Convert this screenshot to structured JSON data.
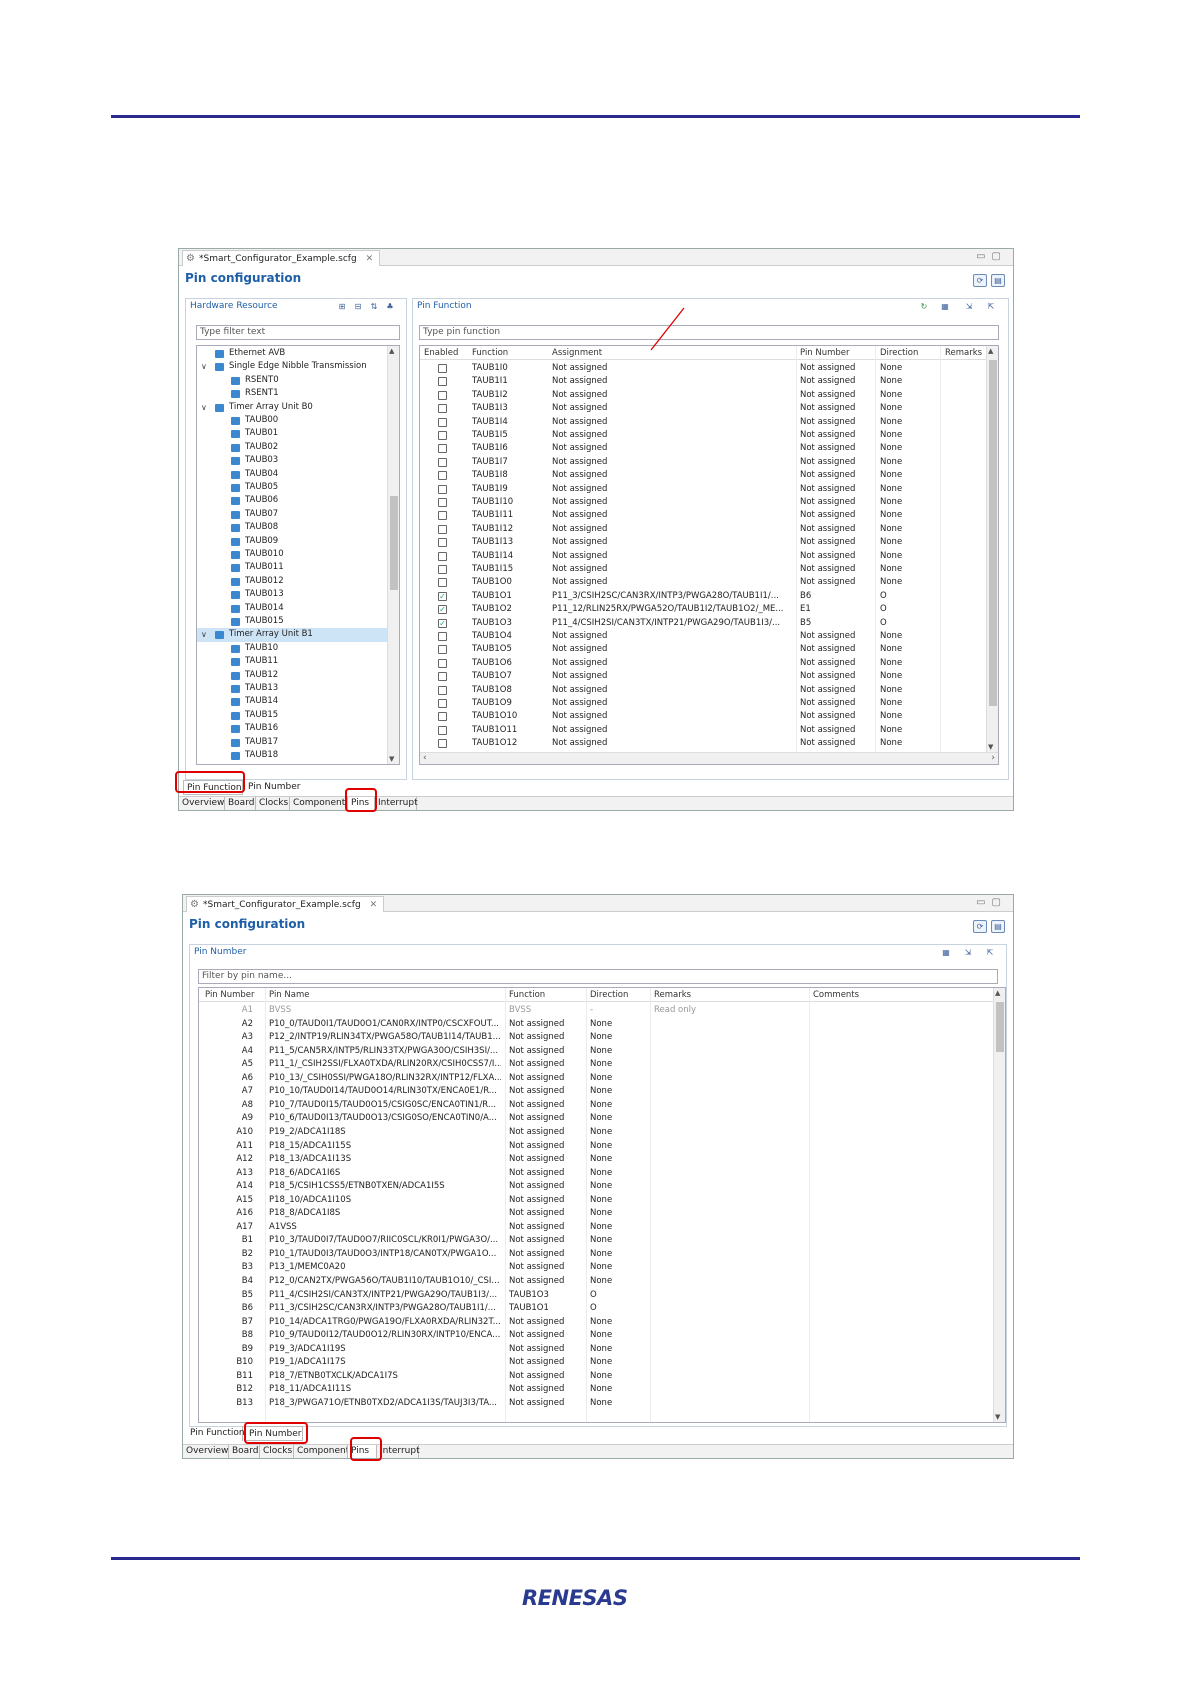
{
  "top": {
    "tab_title": "*Smart_Configurator_Example.scfg",
    "tab_close": "✕",
    "page_title": "Pin configuration",
    "left_pane": {
      "title": "Hardware Resource",
      "filter_placeholder": "Type filter text",
      "items": [
        {
          "label": "Ethernet AVB",
          "level": 1,
          "expand": "",
          "sel": false
        },
        {
          "label": "Single Edge Nibble Transmission",
          "level": 1,
          "expand": "∨",
          "sel": false
        },
        {
          "label": "RSENT0",
          "level": 2,
          "expand": "",
          "sel": false
        },
        {
          "label": "RSENT1",
          "level": 2,
          "expand": "",
          "sel": false
        },
        {
          "label": "Timer Array Unit B0",
          "level": 1,
          "expand": "∨",
          "sel": false
        },
        {
          "label": "TAUB00",
          "level": 2,
          "expand": "",
          "sel": false
        },
        {
          "label": "TAUB01",
          "level": 2,
          "expand": "",
          "sel": false
        },
        {
          "label": "TAUB02",
          "level": 2,
          "expand": "",
          "sel": false
        },
        {
          "label": "TAUB03",
          "level": 2,
          "expand": "",
          "sel": false
        },
        {
          "label": "TAUB04",
          "level": 2,
          "expand": "",
          "sel": false
        },
        {
          "label": "TAUB05",
          "level": 2,
          "expand": "",
          "sel": false
        },
        {
          "label": "TAUB06",
          "level": 2,
          "expand": "",
          "sel": false
        },
        {
          "label": "TAUB07",
          "level": 2,
          "expand": "",
          "sel": false
        },
        {
          "label": "TAUB08",
          "level": 2,
          "expand": "",
          "sel": false
        },
        {
          "label": "TAUB09",
          "level": 2,
          "expand": "",
          "sel": false
        },
        {
          "label": "TAUB010",
          "level": 2,
          "expand": "",
          "sel": false
        },
        {
          "label": "TAUB011",
          "level": 2,
          "expand": "",
          "sel": false
        },
        {
          "label": "TAUB012",
          "level": 2,
          "expand": "",
          "sel": false
        },
        {
          "label": "TAUB013",
          "level": 2,
          "expand": "",
          "sel": false
        },
        {
          "label": "TAUB014",
          "level": 2,
          "expand": "",
          "sel": false
        },
        {
          "label": "TAUB015",
          "level": 2,
          "expand": "",
          "sel": false
        },
        {
          "label": "Timer Array Unit B1",
          "level": 1,
          "expand": "∨",
          "sel": true
        },
        {
          "label": "TAUB10",
          "level": 2,
          "expand": "",
          "sel": false
        },
        {
          "label": "TAUB11",
          "level": 2,
          "expand": "",
          "sel": false
        },
        {
          "label": "TAUB12",
          "level": 2,
          "expand": "",
          "sel": false
        },
        {
          "label": "TAUB13",
          "level": 2,
          "expand": "",
          "sel": false
        },
        {
          "label": "TAUB14",
          "level": 2,
          "expand": "",
          "sel": false
        },
        {
          "label": "TAUB15",
          "level": 2,
          "expand": "",
          "sel": false
        },
        {
          "label": "TAUB16",
          "level": 2,
          "expand": "",
          "sel": false
        },
        {
          "label": "TAUB17",
          "level": 2,
          "expand": "",
          "sel": false
        },
        {
          "label": "TAUB18",
          "level": 2,
          "expand": "",
          "sel": false
        }
      ]
    },
    "right_pane": {
      "title": "Pin Function",
      "filter_placeholder": "Type pin function",
      "columns": [
        "Enabled",
        "Function",
        "Assignment",
        "Pin Number",
        "Direction",
        "Remarks"
      ],
      "rows": [
        {
          "checked": false,
          "function": "TAUB1I0",
          "assignment": "Not assigned",
          "pin": "Not assigned",
          "direction": "None"
        },
        {
          "checked": false,
          "function": "TAUB1I1",
          "assignment": "Not assigned",
          "pin": "Not assigned",
          "direction": "None"
        },
        {
          "checked": false,
          "function": "TAUB1I2",
          "assignment": "Not assigned",
          "pin": "Not assigned",
          "direction": "None"
        },
        {
          "checked": false,
          "function": "TAUB1I3",
          "assignment": "Not assigned",
          "pin": "Not assigned",
          "direction": "None"
        },
        {
          "checked": false,
          "function": "TAUB1I4",
          "assignment": "Not assigned",
          "pin": "Not assigned",
          "direction": "None"
        },
        {
          "checked": false,
          "function": "TAUB1I5",
          "assignment": "Not assigned",
          "pin": "Not assigned",
          "direction": "None"
        },
        {
          "checked": false,
          "function": "TAUB1I6",
          "assignment": "Not assigned",
          "pin": "Not assigned",
          "direction": "None"
        },
        {
          "checked": false,
          "function": "TAUB1I7",
          "assignment": "Not assigned",
          "pin": "Not assigned",
          "direction": "None"
        },
        {
          "checked": false,
          "function": "TAUB1I8",
          "assignment": "Not assigned",
          "pin": "Not assigned",
          "direction": "None"
        },
        {
          "checked": false,
          "function": "TAUB1I9",
          "assignment": "Not assigned",
          "pin": "Not assigned",
          "direction": "None"
        },
        {
          "checked": false,
          "function": "TAUB1I10",
          "assignment": "Not assigned",
          "pin": "Not assigned",
          "direction": "None"
        },
        {
          "checked": false,
          "function": "TAUB1I11",
          "assignment": "Not assigned",
          "pin": "Not assigned",
          "direction": "None"
        },
        {
          "checked": false,
          "function": "TAUB1I12",
          "assignment": "Not assigned",
          "pin": "Not assigned",
          "direction": "None"
        },
        {
          "checked": false,
          "function": "TAUB1I13",
          "assignment": "Not assigned",
          "pin": "Not assigned",
          "direction": "None"
        },
        {
          "checked": false,
          "function": "TAUB1I14",
          "assignment": "Not assigned",
          "pin": "Not assigned",
          "direction": "None"
        },
        {
          "checked": false,
          "function": "TAUB1I15",
          "assignment": "Not assigned",
          "pin": "Not assigned",
          "direction": "None"
        },
        {
          "checked": false,
          "function": "TAUB1O0",
          "assignment": "Not assigned",
          "pin": "Not assigned",
          "direction": "None"
        },
        {
          "checked": true,
          "function": "TAUB1O1",
          "assignment": "P11_3/CSIH2SC/CAN3RX/INTP3/PWGA28O/TAUB1I1/...",
          "pin": "B6",
          "direction": "O"
        },
        {
          "checked": true,
          "function": "TAUB1O2",
          "assignment": "P11_12/RLIN25RX/PWGA52O/TAUB1I2/TAUB1O2/_ME...",
          "pin": "E1",
          "direction": "O"
        },
        {
          "checked": true,
          "function": "TAUB1O3",
          "assignment": "P11_4/CSIH2SI/CAN3TX/INTP21/PWGA29O/TAUB1I3/...",
          "pin": "B5",
          "direction": "O"
        },
        {
          "checked": false,
          "function": "TAUB1O4",
          "assignment": "Not assigned",
          "pin": "Not assigned",
          "direction": "None"
        },
        {
          "checked": false,
          "function": "TAUB1O5",
          "assignment": "Not assigned",
          "pin": "Not assigned",
          "direction": "None"
        },
        {
          "checked": false,
          "function": "TAUB1O6",
          "assignment": "Not assigned",
          "pin": "Not assigned",
          "direction": "None"
        },
        {
          "checked": false,
          "function": "TAUB1O7",
          "assignment": "Not assigned",
          "pin": "Not assigned",
          "direction": "None"
        },
        {
          "checked": false,
          "function": "TAUB1O8",
          "assignment": "Not assigned",
          "pin": "Not assigned",
          "direction": "None"
        },
        {
          "checked": false,
          "function": "TAUB1O9",
          "assignment": "Not assigned",
          "pin": "Not assigned",
          "direction": "None"
        },
        {
          "checked": false,
          "function": "TAUB1O10",
          "assignment": "Not assigned",
          "pin": "Not assigned",
          "direction": "None"
        },
        {
          "checked": false,
          "function": "TAUB1O11",
          "assignment": "Not assigned",
          "pin": "Not assigned",
          "direction": "None"
        },
        {
          "checked": false,
          "function": "TAUB1O12",
          "assignment": "Not assigned",
          "pin": "Not assigned",
          "direction": "None"
        }
      ]
    },
    "bottom_tabs": [
      "Pin Function",
      "Pin Number"
    ],
    "editor_tabs": [
      "Overview",
      "Board",
      "Clocks",
      "Components",
      "Pins",
      "Interrupt"
    ]
  },
  "bottom": {
    "tab_title": "*Smart_Configurator_Example.scfg",
    "tab_close": "✕",
    "page_title": "Pin configuration",
    "pane_title": "Pin Number",
    "filter_placeholder": "Filter by pin name...",
    "columns": [
      "Pin Number",
      "Pin Name",
      "Function",
      "Direction",
      "Remarks",
      "Comments"
    ],
    "rows": [
      {
        "pin": "A1",
        "name": "BVSS",
        "func": "BVSS",
        "dir": "-",
        "remarks": "Read only",
        "ro": true
      },
      {
        "pin": "A2",
        "name": "P10_0/TAUD0I1/TAUD0O1/CAN0RX/INTP0/CSCXFOUT...",
        "func": "Not assigned",
        "dir": "None",
        "remarks": "",
        "ro": false
      },
      {
        "pin": "A3",
        "name": "P12_2/INTP19/RLIN34TX/PWGA58O/TAUB1I14/TAUB1...",
        "func": "Not assigned",
        "dir": "None",
        "remarks": "",
        "ro": false
      },
      {
        "pin": "A4",
        "name": "P11_5/CAN5RX/INTP5/RLIN33TX/PWGA30O/CSIH3SI/...",
        "func": "Not assigned",
        "dir": "None",
        "remarks": "",
        "ro": false
      },
      {
        "pin": "A5",
        "name": "P11_1/_CSIH2SSI/FLXA0TXDA/RLIN20RX/CSIH0CSS7/I...",
        "func": "Not assigned",
        "dir": "None",
        "remarks": "",
        "ro": false
      },
      {
        "pin": "A6",
        "name": "P10_13/_CSIH0SSI/PWGA18O/RLIN32RX/INTP12/FLXA...",
        "func": "Not assigned",
        "dir": "None",
        "remarks": "",
        "ro": false
      },
      {
        "pin": "A7",
        "name": "P10_10/TAUD0I14/TAUD0O14/RLIN30TX/ENCA0E1/R...",
        "func": "Not assigned",
        "dir": "None",
        "remarks": "",
        "ro": false
      },
      {
        "pin": "A8",
        "name": "P10_7/TAUD0I15/TAUD0O15/CSIG0SC/ENCA0TIN1/R...",
        "func": "Not assigned",
        "dir": "None",
        "remarks": "",
        "ro": false
      },
      {
        "pin": "A9",
        "name": "P10_6/TAUD0I13/TAUD0O13/CSIG0SO/ENCA0TIN0/A...",
        "func": "Not assigned",
        "dir": "None",
        "remarks": "",
        "ro": false
      },
      {
        "pin": "A10",
        "name": "P19_2/ADCA1I18S",
        "func": "Not assigned",
        "dir": "None",
        "remarks": "",
        "ro": false
      },
      {
        "pin": "A11",
        "name": "P18_15/ADCA1I15S",
        "func": "Not assigned",
        "dir": "None",
        "remarks": "",
        "ro": false
      },
      {
        "pin": "A12",
        "name": "P18_13/ADCA1I13S",
        "func": "Not assigned",
        "dir": "None",
        "remarks": "",
        "ro": false
      },
      {
        "pin": "A13",
        "name": "P18_6/ADCA1I6S",
        "func": "Not assigned",
        "dir": "None",
        "remarks": "",
        "ro": false
      },
      {
        "pin": "A14",
        "name": "P18_5/CSIH1CSS5/ETNB0TXEN/ADCA1I5S",
        "func": "Not assigned",
        "dir": "None",
        "remarks": "",
        "ro": false
      },
      {
        "pin": "A15",
        "name": "P18_10/ADCA1I10S",
        "func": "Not assigned",
        "dir": "None",
        "remarks": "",
        "ro": false
      },
      {
        "pin": "A16",
        "name": "P18_8/ADCA1I8S",
        "func": "Not assigned",
        "dir": "None",
        "remarks": "",
        "ro": false
      },
      {
        "pin": "A17",
        "name": "A1VSS",
        "func": "Not assigned",
        "dir": "None",
        "remarks": "",
        "ro": false
      },
      {
        "pin": "B1",
        "name": "P10_3/TAUD0I7/TAUD0O7/RIIC0SCL/KR0I1/PWGA3O/...",
        "func": "Not assigned",
        "dir": "None",
        "remarks": "",
        "ro": false
      },
      {
        "pin": "B2",
        "name": "P10_1/TAUD0I3/TAUD0O3/INTP18/CAN0TX/PWGA1O...",
        "func": "Not assigned",
        "dir": "None",
        "remarks": "",
        "ro": false
      },
      {
        "pin": "B3",
        "name": "P13_1/MEMC0A20",
        "func": "Not assigned",
        "dir": "None",
        "remarks": "",
        "ro": false
      },
      {
        "pin": "B4",
        "name": "P12_0/CAN2TX/PWGA56O/TAUB1I10/TAUB1O10/_CSI...",
        "func": "Not assigned",
        "dir": "None",
        "remarks": "",
        "ro": false
      },
      {
        "pin": "B5",
        "name": "P11_4/CSIH2SI/CAN3TX/INTP21/PWGA29O/TAUB1I3/...",
        "func": "TAUB1O3",
        "dir": "O",
        "remarks": "",
        "ro": false
      },
      {
        "pin": "B6",
        "name": "P11_3/CSIH2SC/CAN3RX/INTP3/PWGA28O/TAUB1I1/...",
        "func": "TAUB1O1",
        "dir": "O",
        "remarks": "",
        "ro": false
      },
      {
        "pin": "B7",
        "name": "P10_14/ADCA1TRG0/PWGA19O/FLXA0RXDA/RLIN32T...",
        "func": "Not assigned",
        "dir": "None",
        "remarks": "",
        "ro": false
      },
      {
        "pin": "B8",
        "name": "P10_9/TAUD0I12/TAUD0O12/RLIN30RX/INTP10/ENCA...",
        "func": "Not assigned",
        "dir": "None",
        "remarks": "",
        "ro": false
      },
      {
        "pin": "B9",
        "name": "P19_3/ADCA1I19S",
        "func": "Not assigned",
        "dir": "None",
        "remarks": "",
        "ro": false
      },
      {
        "pin": "B10",
        "name": "P19_1/ADCA1I17S",
        "func": "Not assigned",
        "dir": "None",
        "remarks": "",
        "ro": false
      },
      {
        "pin": "B11",
        "name": "P18_7/ETNB0TXCLK/ADCA1I7S",
        "func": "Not assigned",
        "dir": "None",
        "remarks": "",
        "ro": false
      },
      {
        "pin": "B12",
        "name": "P18_11/ADCA1I11S",
        "func": "Not assigned",
        "dir": "None",
        "remarks": "",
        "ro": false
      },
      {
        "pin": "B13",
        "name": "P18_3/PWGA71O/ETNB0TXD2/ADCA1I3S/TAUJ3I3/TA...",
        "func": "Not assigned",
        "dir": "None",
        "remarks": "",
        "ro": false
      }
    ],
    "bottom_tabs": [
      "Pin Function",
      "Pin Number"
    ],
    "editor_tabs": [
      "Overview",
      "Board",
      "Clocks",
      "Components",
      "Pins",
      "Interrupt"
    ]
  },
  "logo": "RENESAS",
  "colors": {
    "accent": "#1f5fa8",
    "rule": "#2a2a8e",
    "highlight": "#e10000",
    "selection": "#cde4f7"
  }
}
